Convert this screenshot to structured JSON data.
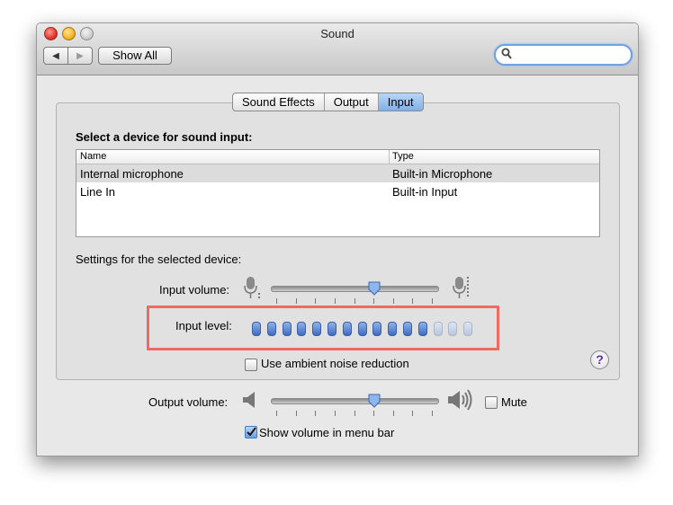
{
  "window": {
    "title": "Sound"
  },
  "toolbar": {
    "back_label": "◀",
    "forward_label": "▶",
    "show_all_label": "Show All",
    "search_placeholder": ""
  },
  "tabs": [
    {
      "label": "Sound Effects"
    },
    {
      "label": "Output"
    },
    {
      "label": "Input",
      "active": true
    }
  ],
  "input_panel": {
    "heading": "Select a device for sound input:",
    "columns": [
      "Name",
      "Type"
    ],
    "devices": [
      {
        "name": "Internal microphone",
        "type": "Built-in Microphone",
        "selected": true
      },
      {
        "name": "Line In",
        "type": "Built-in Input",
        "selected": false
      }
    ],
    "settings_label": "Settings for the selected device:",
    "input_volume_label": "Input volume:",
    "input_volume_value": 0.63,
    "input_level_label": "Input level:",
    "input_level_total": 15,
    "input_level_active": 12,
    "ambient_noise_label": "Use ambient noise reduction",
    "ambient_noise_checked": false,
    "help_label": "?"
  },
  "output": {
    "output_volume_label": "Output volume:",
    "output_volume_value": 0.63,
    "mute_label": "Mute",
    "mute_checked": false,
    "show_volume_label": "Show volume in menu bar",
    "show_volume_checked": true
  },
  "colors": {
    "highlight_box": "#ef6a62",
    "accent": "#6aa0e6",
    "level_on": "#3f6cc0"
  }
}
